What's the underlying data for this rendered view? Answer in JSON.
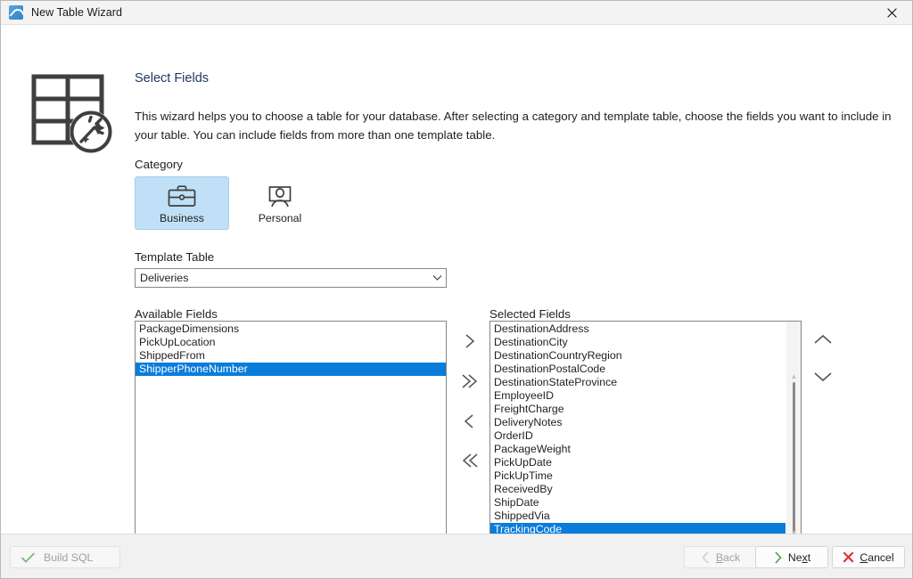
{
  "window": {
    "title": "New Table Wizard",
    "app_icon": "wizard-app-icon",
    "close_label": "✕"
  },
  "header": {
    "icon": "table-magic-wand-icon",
    "title": "Select Fields",
    "description": "This wizard helps you to choose a table for your database. After selecting a category and template table, choose the fields you want to include in your table. You can include fields from more than one template table."
  },
  "category": {
    "label": "Category",
    "selected": "Business",
    "options": [
      {
        "label": "Business",
        "icon": "briefcase-icon",
        "selected": true
      },
      {
        "label": "Personal",
        "icon": "person-monitor-icon",
        "selected": false
      }
    ]
  },
  "template_table": {
    "label": "Template Table",
    "value": "Deliveries",
    "placeholder": "Deliveries",
    "arrow_icon": "chevron-down-icon"
  },
  "available_fields": {
    "label": "Available Fields",
    "items": [
      {
        "label": "PackageDimensions",
        "selected": false
      },
      {
        "label": "PickUpLocation",
        "selected": false
      },
      {
        "label": "ShippedFrom",
        "selected": false
      },
      {
        "label": "ShipperPhoneNumber",
        "selected": true
      }
    ]
  },
  "selected_fields": {
    "label": "Selected Fields",
    "items": [
      {
        "label": "DestinationAddress",
        "selected": false
      },
      {
        "label": "DestinationCity",
        "selected": false
      },
      {
        "label": "DestinationCountryRegion",
        "selected": false
      },
      {
        "label": "DestinationPostalCode",
        "selected": false
      },
      {
        "label": "DestinationStateProvince",
        "selected": false
      },
      {
        "label": "EmployeeID",
        "selected": false
      },
      {
        "label": "FreightCharge",
        "selected": false
      },
      {
        "label": "DeliveryNotes",
        "selected": false
      },
      {
        "label": "OrderID",
        "selected": false
      },
      {
        "label": "PackageWeight",
        "selected": false
      },
      {
        "label": "PickUpDate",
        "selected": false
      },
      {
        "label": "PickUpTime",
        "selected": false
      },
      {
        "label": "ReceivedBy",
        "selected": false
      },
      {
        "label": "ShipDate",
        "selected": false
      },
      {
        "label": "ShippedVia",
        "selected": false
      },
      {
        "label": "TrackingCode",
        "selected": true
      }
    ],
    "scrollbar": {
      "visible": true
    }
  },
  "transfer_buttons": [
    {
      "name": "move-right-button",
      "icon": "chevron-right-icon",
      "glyph": "›"
    },
    {
      "name": "move-all-right-button",
      "icon": "chevron-double-right-icon",
      "glyph": "»"
    },
    {
      "name": "move-left-button",
      "icon": "chevron-left-icon",
      "glyph": "‹"
    },
    {
      "name": "move-all-left-button",
      "icon": "chevron-double-left-icon",
      "glyph": "«"
    }
  ],
  "order_buttons": [
    {
      "name": "move-up-button",
      "icon": "chevron-up-icon"
    },
    {
      "name": "move-down-button",
      "icon": "chevron-down-icon"
    }
  ],
  "footer": {
    "build_sql": {
      "label": "Build SQL",
      "icon": "check-icon",
      "enabled": false
    },
    "back": {
      "label_pre": "",
      "mnemonic": "B",
      "label_post": "ack",
      "icon": "chevron-left-icon",
      "enabled": false
    },
    "next": {
      "label_pre": "Ne",
      "mnemonic": "x",
      "label_post": "t",
      "icon": "chevron-right-icon",
      "enabled": true
    },
    "cancel": {
      "label_pre": "",
      "mnemonic": "C",
      "label_post": "ancel",
      "icon": "x-icon",
      "enabled": true
    }
  },
  "colors": {
    "selection_blue": "#0a7cdb",
    "category_selected_bg": "#bfe0f7",
    "title_navy": "#1f3864",
    "accent_green": "#5faf5f",
    "accent_red": "#e03030",
    "titlebar_bg": "#f3f3f3",
    "footer_bg": "#f1f1f1"
  }
}
